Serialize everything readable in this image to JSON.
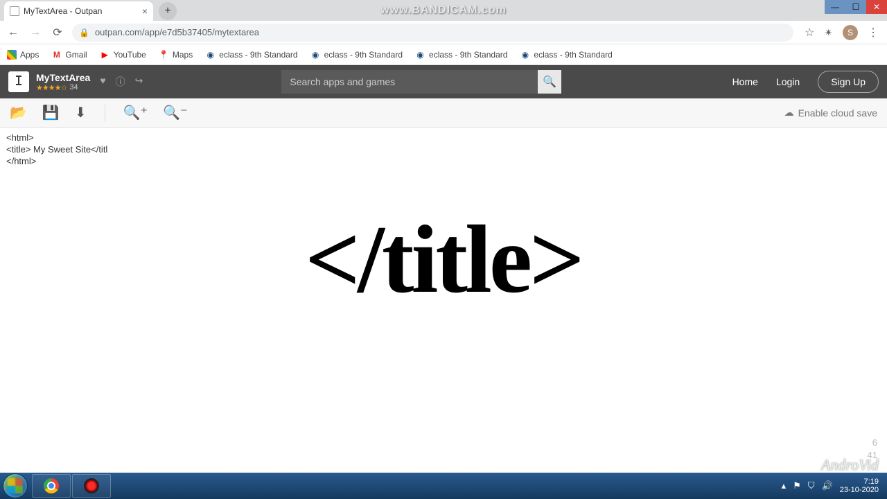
{
  "watermark": "www.BANDICAM.com",
  "tab": {
    "title": "MyTextArea - Outpan"
  },
  "url": "outpan.com/app/e7d5b37405/mytextarea",
  "avatar_letter": "S",
  "bookmarks": {
    "apps": "Apps",
    "gmail": "Gmail",
    "youtube": "YouTube",
    "maps": "Maps",
    "eclass1": "eclass - 9th Standard",
    "eclass2": "eclass - 9th Standard",
    "eclass3": "eclass - 9th Standard",
    "eclass4": "eclass - 9th Standard"
  },
  "outpan": {
    "app_name": "MyTextArea",
    "rating_count": "34",
    "search_placeholder": "Search apps and games",
    "home": "Home",
    "login": "Login",
    "signup": "Sign Up"
  },
  "cloud_save": "Enable cloud save",
  "editor": {
    "line1": "<html>",
    "line2": "<title> My Sweet Site</titl",
    "line3": "</html>"
  },
  "big_text": "</title>",
  "cursor": {
    "line": "6",
    "col": "41"
  },
  "androvid": "AndroVid",
  "tray": {
    "time": "7:19",
    "date": "23-10-2020"
  }
}
